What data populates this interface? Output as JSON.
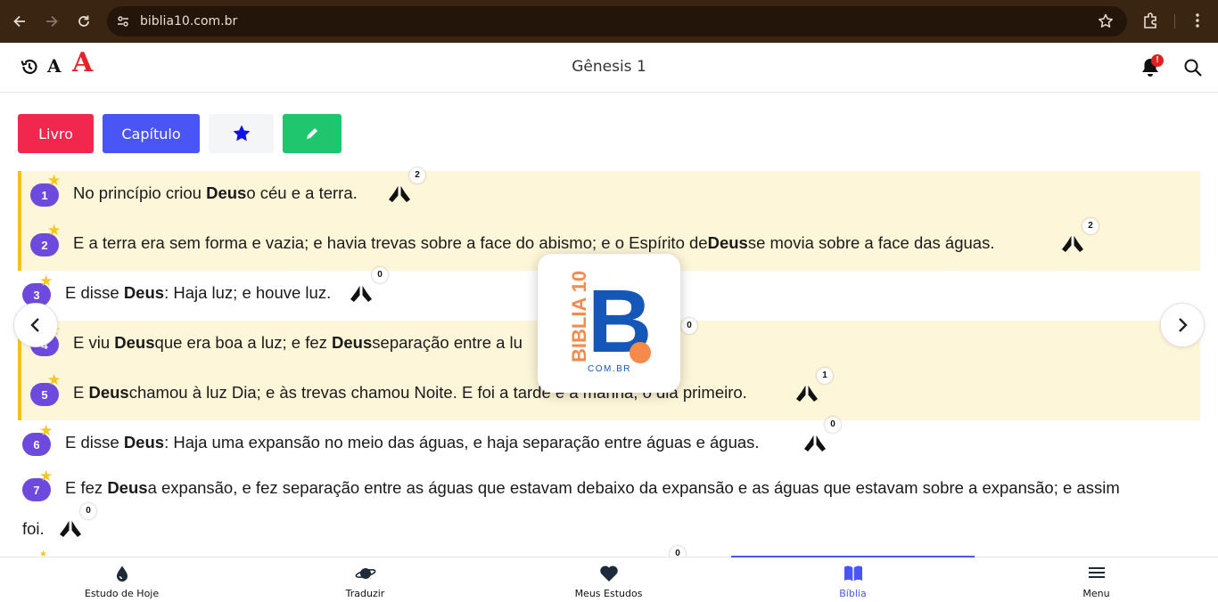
{
  "browser": {
    "url": "biblia10.com.br"
  },
  "header": {
    "title": "Gênesis 1",
    "font_small_label": "A",
    "font_large_label": "A",
    "notification_badge": "!"
  },
  "actions": {
    "livro": "Livro",
    "capitulo": "Capítulo"
  },
  "verses": [
    {
      "num": "1",
      "pre": "No princípio criou ",
      "bold": "Deus",
      "post": " o céu e a terra.",
      "count": "2",
      "highlighted": true
    },
    {
      "num": "2",
      "pre": "E a terra era sem forma e vazia; e havia trevas sobre a face do abismo; e o Espírito de ",
      "bold": "Deus",
      "post": " se movia sobre a face das águas.",
      "count": "2",
      "highlighted": true
    },
    {
      "num": "3",
      "pre": "E disse ",
      "bold": "Deus",
      "post": ": Haja luz; e houve luz.",
      "count": "0",
      "highlighted": false
    },
    {
      "num": "4",
      "pre": "E viu ",
      "bold": "Deus",
      "mid": " que era boa a luz; e fez ",
      "bold2": "Deus",
      "post": " separação entre a lu",
      "count": "0",
      "highlighted": true
    },
    {
      "num": "5",
      "pre": "E ",
      "bold": "Deus",
      "post": " chamou à luz Dia; e às trevas chamou Noite. E foi a tarde e a manhã, o dia primeiro.",
      "count": "1",
      "highlighted": true
    },
    {
      "num": "6",
      "pre": "E disse ",
      "bold": "Deus",
      "post": ": Haja uma expansão no meio das águas, e haja separação entre águas e águas.",
      "count": "0",
      "highlighted": false
    },
    {
      "num": "7",
      "pre": "E fez ",
      "bold": "Deus",
      "post": " a expansão, e fez separação entre as águas que estavam debaixo da expansão e as águas que estavam sobre a expansão; e assim",
      "post2": "foi.",
      "count": "0",
      "highlighted": false
    }
  ],
  "next_verse_count": "0",
  "logo": {
    "brand": "BIBLIA 10",
    "letter": "B",
    "domain": "COM.BR"
  },
  "bottom_nav": {
    "items": [
      {
        "label": "Estudo de Hoje",
        "icon": "drop-icon"
      },
      {
        "label": "Traduzir",
        "icon": "planet-icon"
      },
      {
        "label": "Meus Estudos",
        "icon": "heart-icon"
      },
      {
        "label": "Bíblia",
        "icon": "book-icon",
        "active": true
      },
      {
        "label": "Menu",
        "icon": "hamburger-icon"
      }
    ]
  },
  "colors": {
    "accent": "#4a55f5",
    "verse_number": "#6e49dd",
    "highlight": "#fef6d8",
    "highlight_border": "#f2c419",
    "livro": "#f2274e",
    "edit": "#1fc66d"
  }
}
